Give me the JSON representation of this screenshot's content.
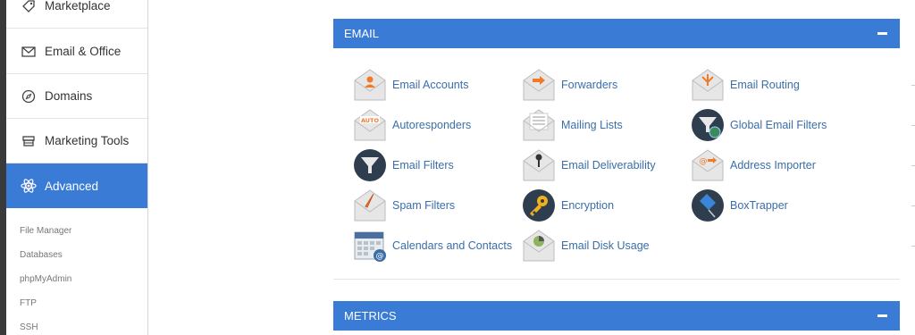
{
  "sidebar": {
    "items": [
      {
        "label": "Marketplace",
        "icon": "tag-icon"
      },
      {
        "label": "Email & Office",
        "icon": "envelope-icon"
      },
      {
        "label": "Domains",
        "icon": "compass-icon"
      },
      {
        "label": "Marketing Tools",
        "icon": "store-icon"
      },
      {
        "label": "Advanced",
        "icon": "atom-icon"
      }
    ],
    "subitems": [
      "File Manager",
      "Databases",
      "phpMyAdmin",
      "FTP",
      "SSH"
    ]
  },
  "email_panel": {
    "title": "EMAIL",
    "tools": [
      [
        "Email Accounts",
        "Forwarders",
        "Email Routing"
      ],
      [
        "Autoresponders",
        "Mailing Lists",
        "Global Email Filters"
      ],
      [
        "Email Filters",
        "Email Deliverability",
        "Address Importer"
      ],
      [
        "Spam Filters",
        "Encryption",
        "BoxTrapper"
      ],
      [
        "Calendars and Contacts",
        "Email Disk Usage"
      ]
    ]
  },
  "metrics_panel": {
    "title": "METRICS"
  },
  "colors": {
    "accent": "#3a7bd5",
    "link": "#3a6ea8"
  }
}
